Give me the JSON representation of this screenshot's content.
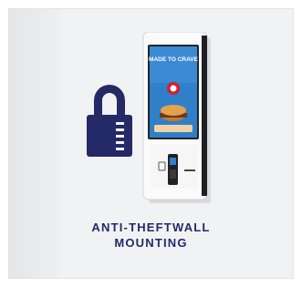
{
  "caption": {
    "line1": "ANTI-THEFTWALL",
    "line2": "MOUNTING"
  },
  "kiosk_screen": {
    "headline": "MADE TO CRAVE"
  },
  "colors": {
    "brand_navy": "#242a66",
    "background": "#f1f2f4",
    "screen_blue": "#2f7fc9",
    "brand_red": "#d3202d"
  },
  "icons": {
    "lock": "padlock-icon"
  }
}
